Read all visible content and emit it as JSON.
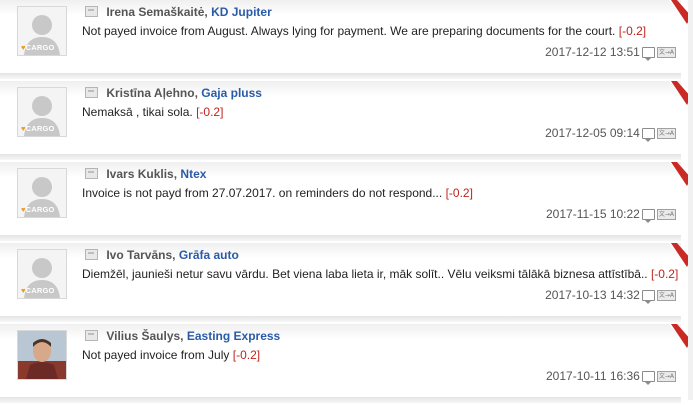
{
  "reviews": [
    {
      "author": "Irena Semaškaitė,",
      "company": "KD Jupiter",
      "text": "Not payed invoice from August. Always lying for payment. We are preparing documents for the court.",
      "score": "[-0.2]",
      "date": "2017-12-12 13:51",
      "avatar": "cargo-placeholder",
      "logo_text": "CARGO",
      "translate_label": "文→A"
    },
    {
      "author": "Kristīna Aļehno,",
      "company": "Gaja pluss",
      "text": "Nemaksā , tikai sola.",
      "score": "[-0.2]",
      "date": "2017-12-05 09:14",
      "avatar": "cargo-placeholder",
      "logo_text": "CARGO",
      "translate_label": "文→A"
    },
    {
      "author": "Ivars Kuklis,",
      "company": "Ntex",
      "text": "Invoice is not payd from 27.07.2017. on reminders do not respond...",
      "score": "[-0.2]",
      "date": "2017-11-15 10:22",
      "avatar": "cargo-placeholder",
      "logo_text": "CARGO",
      "translate_label": "文→A"
    },
    {
      "author": "Ivo Tarvāns,",
      "company": "Grāfa auto",
      "text": "Diemžēl, jaunieši netur savu vārdu. Bet viena laba lieta ir, māk solīt.. Vēlu veiksmi tālākā biznesa attīstībā..",
      "score": "[-0.2]",
      "date": "2017-10-13 14:32",
      "avatar": "cargo-placeholder",
      "logo_text": "CARGO",
      "translate_label": "文→A"
    },
    {
      "author": "Vilius Šaulys,",
      "company": "Easting Express",
      "text": "Not payed invoice from July",
      "score": "[-0.2]",
      "date": "2017-10-11 16:36",
      "avatar": "photo",
      "logo_text": "",
      "translate_label": "文→A"
    }
  ],
  "colors": {
    "company": "#2a5ba8",
    "score": "#c0241d",
    "corner": "#c92a26"
  }
}
